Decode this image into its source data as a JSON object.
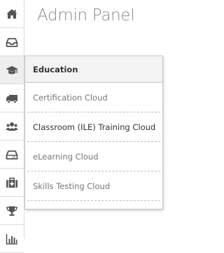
{
  "page": {
    "title": "Admin Panel"
  },
  "sidebar": {
    "items": [
      {
        "icon": "home-icon",
        "active": false
      },
      {
        "icon": "inbox-icon",
        "active": false
      },
      {
        "icon": "graduation-cap-icon",
        "active": true
      },
      {
        "icon": "truck-icon",
        "active": false
      },
      {
        "icon": "users-icon",
        "active": false
      },
      {
        "icon": "hard-drive-icon",
        "active": false
      },
      {
        "icon": "medkit-icon",
        "active": false
      },
      {
        "icon": "trophy-icon",
        "active": false
      },
      {
        "icon": "bar-chart-icon",
        "active": false
      }
    ]
  },
  "flyout": {
    "header": "Education",
    "items": [
      {
        "label": "Certification Cloud"
      },
      {
        "label": "Classroom (ILE) Training Cloud"
      },
      {
        "label": "eLearning Cloud"
      },
      {
        "label": "Skills Testing Cloud"
      }
    ]
  },
  "colors": {
    "icon": "#555555",
    "title": "#888888",
    "active_bg": "#eeeeee",
    "header_bg": "#f3f3f3"
  }
}
